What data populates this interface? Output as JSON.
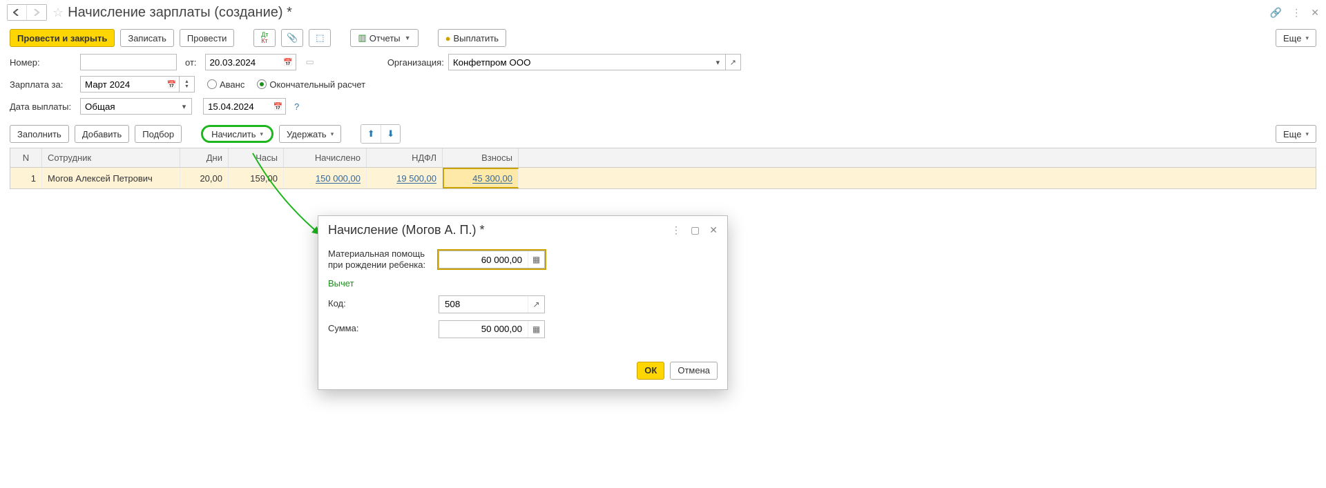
{
  "header": {
    "title": "Начисление зарплаты (создание) *"
  },
  "toolbar": {
    "post_close": "Провести и закрыть",
    "save": "Записать",
    "post": "Провести",
    "reports": "Отчеты",
    "pay": "Выплатить",
    "more": "Еще"
  },
  "form": {
    "number_label": "Номер:",
    "number_value": "",
    "from_label": "от:",
    "from_value": "20.03.2024",
    "org_label": "Организация:",
    "org_value": "Конфетпром ООО",
    "salary_for_label": "Зарплата за:",
    "salary_for_value": "Март 2024",
    "advance_label": "Аванс",
    "final_label": "Окончательный расчет",
    "pay_date_label": "Дата выплаты:",
    "pay_date_kind": "Общая",
    "pay_date_value": "15.04.2024"
  },
  "tableToolbar": {
    "fill": "Заполнить",
    "add": "Добавить",
    "select": "Подбор",
    "accrue": "Начислить",
    "withhold": "Удержать",
    "more": "Еще"
  },
  "table": {
    "headers": {
      "n": "N",
      "emp": "Сотрудник",
      "days": "Дни",
      "hours": "Часы",
      "accrued": "Начислено",
      "ndfl": "НДФЛ",
      "fees": "Взносы"
    },
    "rows": [
      {
        "n": "1",
        "emp": "Могов Алексей Петрович",
        "days": "20,00",
        "hours": "159,00",
        "accrued": "150 000,00",
        "ndfl": "19 500,00",
        "fees": "45 300,00"
      }
    ]
  },
  "dialog": {
    "title": "Начисление (Могов А. П.) *",
    "field1_label": "Материальная помощь при рождении ребенка:",
    "field1_value": "60 000,00",
    "section": "Вычет",
    "code_label": "Код:",
    "code_value": "508",
    "sum_label": "Сумма:",
    "sum_value": "50 000,00",
    "ok": "ОК",
    "cancel": "Отмена"
  }
}
